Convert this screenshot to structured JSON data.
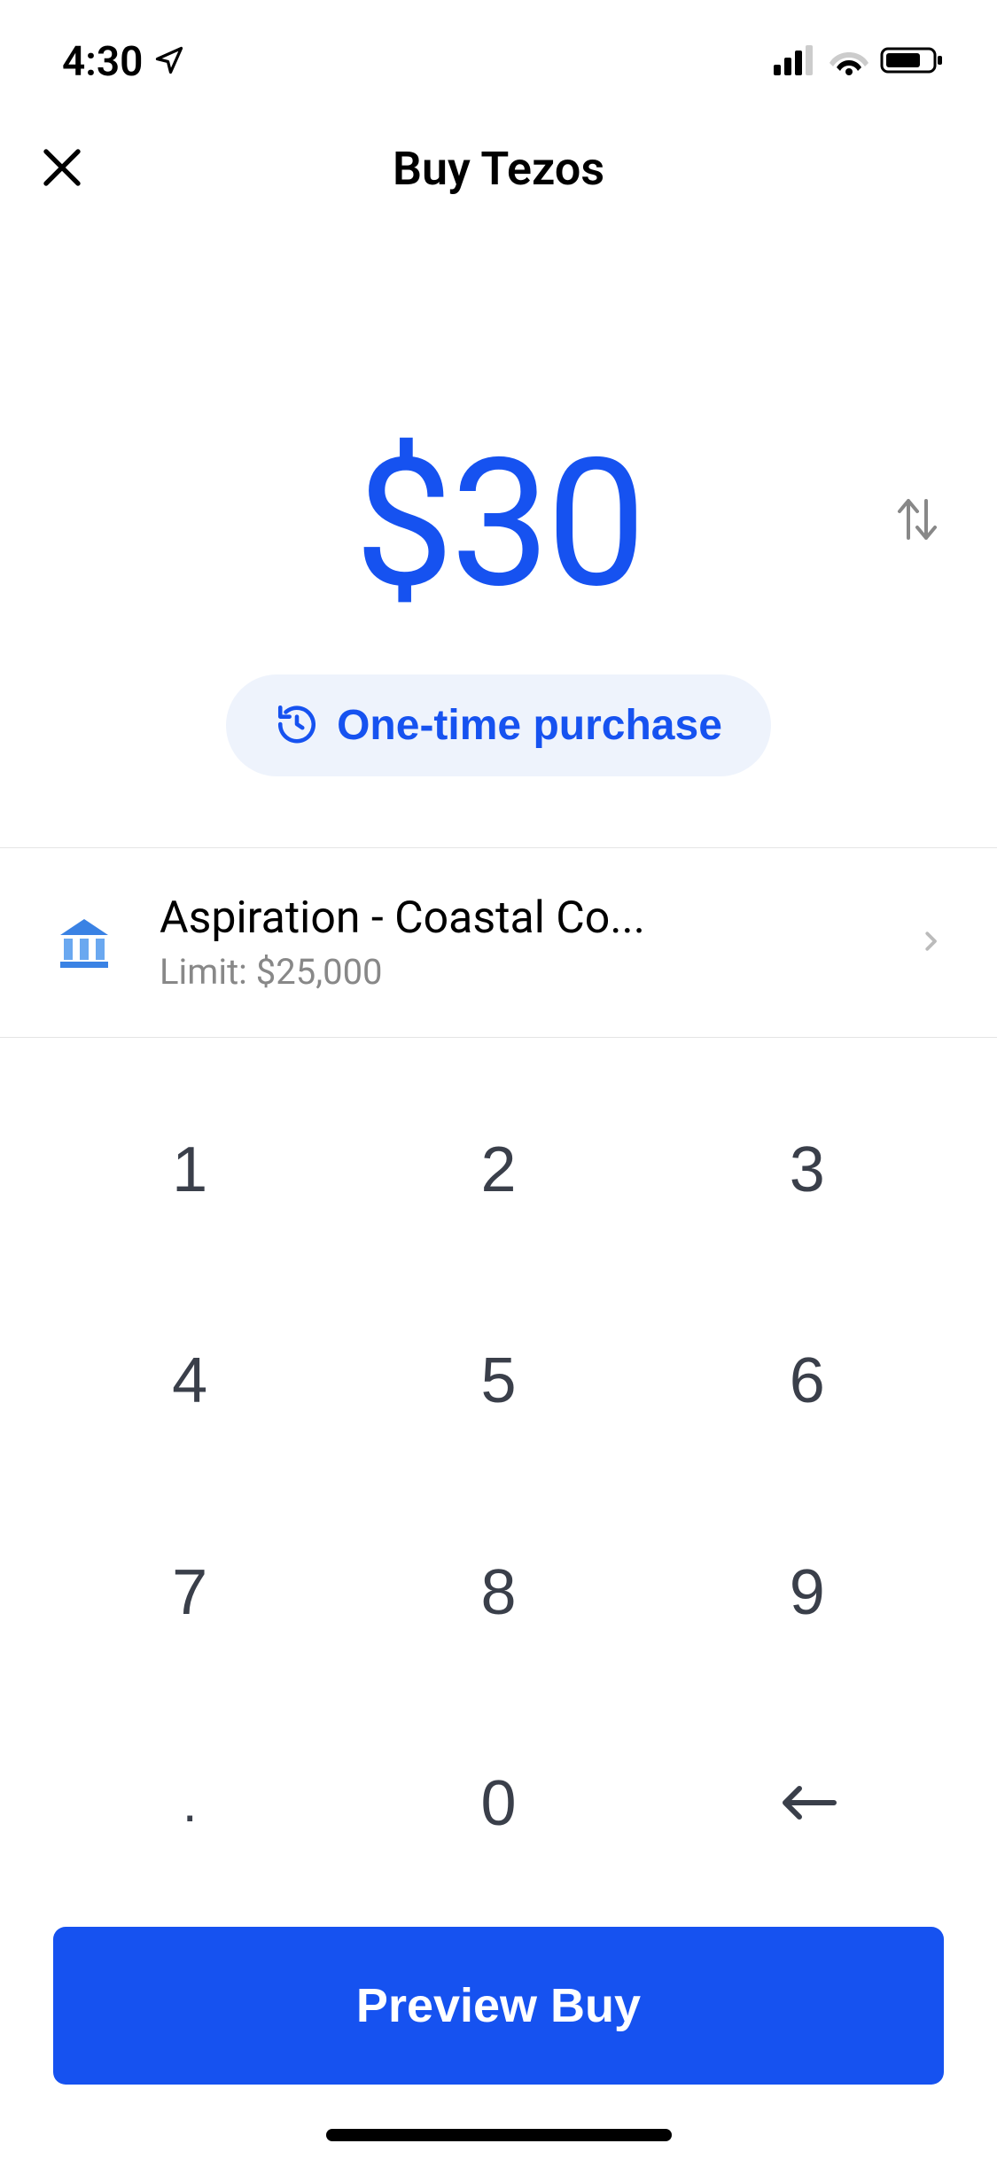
{
  "status_bar": {
    "time": "4:30"
  },
  "header": {
    "title": "Buy Tezos"
  },
  "amount": "$30",
  "purchase_type": {
    "label": "One-time purchase"
  },
  "payment_method": {
    "name": "Aspiration - Coastal Co...",
    "limit": "Limit: $25,000"
  },
  "keypad": {
    "k1": "1",
    "k2": "2",
    "k3": "3",
    "k4": "4",
    "k5": "5",
    "k6": "6",
    "k7": "7",
    "k8": "8",
    "k9": "9",
    "kdot": ".",
    "k0": "0"
  },
  "cta": {
    "preview": "Preview Buy"
  }
}
